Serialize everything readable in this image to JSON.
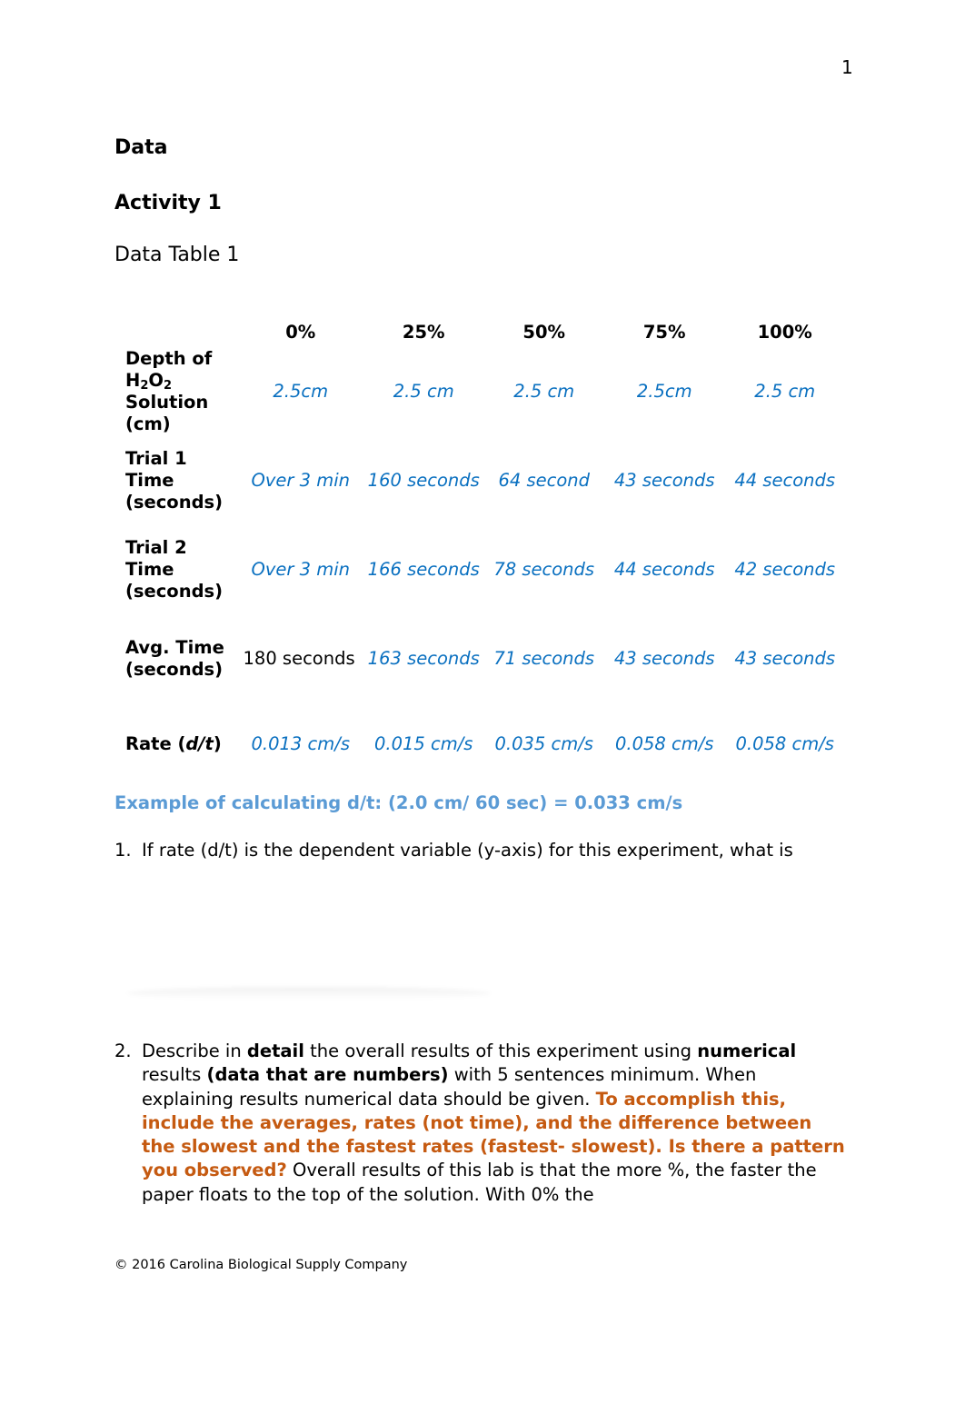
{
  "page_number": "1",
  "headings": {
    "section": "Data",
    "activity": "Activity 1",
    "table_title": "Data Table 1"
  },
  "table": {
    "columns": [
      "0%",
      "25%",
      "50%",
      "75%",
      "100%"
    ],
    "rows": [
      {
        "label_parts": [
          "Depth of H",
          "2",
          "O",
          "2",
          " Solution (cm)"
        ],
        "values": [
          "2.5cm",
          "2.5 cm",
          "2.5 cm",
          "2.5cm",
          "2.5 cm"
        ]
      },
      {
        "label": "Trial 1 Time (seconds)",
        "values": [
          "Over 3 min",
          "160 seconds",
          "64 second",
          "43 seconds",
          "44 seconds"
        ]
      },
      {
        "label": "Trial 2 Time (seconds)",
        "values": [
          "Over 3 min",
          "166 seconds",
          "78 seconds",
          "44 seconds",
          "42 seconds"
        ]
      },
      {
        "label": "Avg. Time (seconds)",
        "values": [
          "180 seconds",
          "163 seconds",
          "71 seconds",
          "43 seconds",
          "43 seconds"
        ]
      },
      {
        "label_prefix": "Rate (",
        "label_italic": "d/t",
        "label_suffix": ")",
        "values": [
          "0.013 cm/s",
          "0.015 cm/s",
          "0.035 cm/s",
          "0.058 cm/s",
          "0.058 cm/s"
        ]
      }
    ]
  },
  "example": "Example of calculating d/t: (2.0 cm/ 60 sec) = 0.033 cm/s",
  "questions": [
    {
      "number": "1.",
      "text": "If rate (d/t) is the dependent variable (y-axis) for this experiment, what is"
    },
    {
      "number": "2.",
      "parts": {
        "p1": "Describe in ",
        "b1": "detail",
        "p2": " the overall results of this experiment using ",
        "b2": "numerical",
        "p3": " results ",
        "b3": "(data that are numbers)",
        "p4": " with 5 sentences minimum. When explaining results numerical data should be given. ",
        "orange": "To accomplish this, include the averages, rates (not time), and the difference between the slowest and the fastest rates (fastest- slowest). Is there a pattern you observed?",
        "answer": " Overall results of this lab is that the more %, the faster the paper floats to the top of the solution. With 0% the"
      }
    }
  ],
  "footer": "© 2016 Carolina Biological Supply Company",
  "colors": {
    "answer_blue": "#0a70c0",
    "example_blue": "#5b9bd5",
    "instruction_orange": "#c55a11"
  }
}
